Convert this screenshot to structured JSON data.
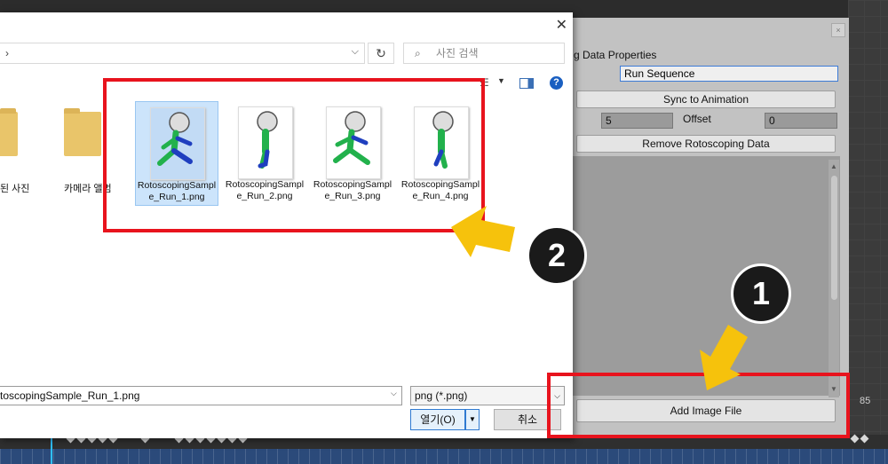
{
  "colors": {
    "annotation_red": "#e8131d",
    "arrow_yellow": "#f6c20c",
    "badge": "#1a1a1a"
  },
  "timeline": {
    "frame_number": "85"
  },
  "panel": {
    "title": "g Data Properties",
    "sequence_name": "Run Sequence",
    "sync_button": "Sync to Animation",
    "start_value": "5",
    "offset_label": "Offset",
    "offset_value": "0",
    "remove_button": "Remove Rotoscoping Data",
    "add_image_button": "Add Image File"
  },
  "dialog": {
    "address_chevron": "›",
    "search_placeholder": "사진 검색",
    "folders": [
      {
        "label": "된 사진"
      },
      {
        "label": "카메라 앨범"
      }
    ],
    "files": [
      {
        "name": "RotoscopingSample_Run_1.png",
        "selected": true
      },
      {
        "name": "RotoscopingSample_Run_2.png",
        "selected": false
      },
      {
        "name": "RotoscopingSample_Run_3.png",
        "selected": false
      },
      {
        "name": "RotoscopingSample_Run_4.png",
        "selected": false
      }
    ],
    "filename_value": "toscopingSample_Run_1.png",
    "filetype_value": "png (*.png)",
    "open_button": "열기(O)",
    "cancel_button": "취소"
  },
  "annotations": {
    "badge_1": "1",
    "badge_2": "2"
  }
}
